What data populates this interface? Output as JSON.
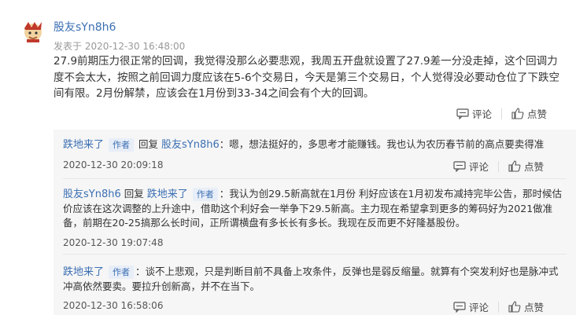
{
  "post": {
    "author": "股友sYn8h6",
    "time": "发表于 2020-12-30 16:48:00",
    "body": "27.9前期压力很正常的回调，我觉得没那么必要悲观，我周五开盘就设置了27.9差一分没走掉，这个回调力度不会太大，按照之前回调力度应该在5-6个交易日，今天是第三个交易日，个人觉得没必要动仓位了下跌空间有限。2月份解禁，应该会在1月份到33-34之间会有个大的回调。",
    "comment_label": "评论",
    "like_label": "点赞"
  },
  "replies": [
    {
      "author": "跌地来了",
      "badge": "作者",
      "reply_word": "回复",
      "target": "股友sYn8h6",
      "text": "：嗯，想法挺好的，多思考才能赚钱。我也认为农历春节前的高点要卖得准",
      "time": "2020-12-30 20:09:18",
      "comment_label": "评论",
      "like_label": "点赞"
    },
    {
      "author": "股友sYn8h6",
      "badge": "",
      "reply_word": "回复",
      "target": "跌地来了",
      "target_badge": "作者",
      "text": "：我认为创29.5新高就在1月份 利好应该在1月初发布减持完毕公告，那时候估价应该在这次调整的上升途中，借助这个利好会一举争下29.5新高。主力现在希望拿到更多的筹码好为2021做准备，前期在20-25搞那么长时间，正所谓横盘有多长长有多长。我现在反而更不好隆基股份。",
      "time": "2020-12-30 19:07:48",
      "comment_label": "评论",
      "like_label": "点赞"
    },
    {
      "author": "跌地来了",
      "badge": "作者",
      "text": "：谈不上悲观，只是判断目前不具备上攻条件，反弹也是弱反缩量。就算有个突发利好也是脉冲式冲高依然要卖。要拉升创新高，并不在当下。",
      "time": "2020-12-30 16:58:06",
      "comment_label": "评论",
      "like_label": "点赞"
    }
  ],
  "colors": {
    "link": "#3b6fb3",
    "badge_bg": "#e8eef8",
    "reply_bg": "#f6f6f6"
  }
}
